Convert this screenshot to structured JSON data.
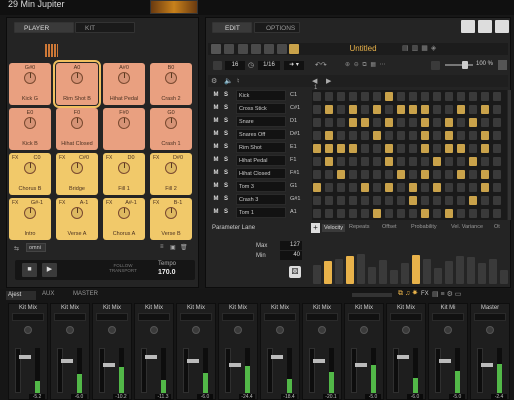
{
  "window": {
    "title": "29 Min Jupiter"
  },
  "left": {
    "tabs": [
      "PLAYER",
      "KIT"
    ],
    "output": "omni",
    "pads": [
      {
        "note": "G#0",
        "label": "Kick G",
        "color": "red"
      },
      {
        "note": "A0",
        "label": "Rim Shot B",
        "color": "red",
        "selected": true
      },
      {
        "note": "A#0",
        "label": "Hihat Pedal",
        "color": "red"
      },
      {
        "note": "B0",
        "label": "Crash 2",
        "color": "red"
      },
      {
        "note": "E0",
        "label": "Kick B",
        "color": "red"
      },
      {
        "note": "F0",
        "label": "Hihat Closed",
        "color": "red"
      },
      {
        "note": "F#0",
        "label": "",
        "color": "red"
      },
      {
        "note": "G0",
        "label": "Crash 1",
        "color": "red"
      },
      {
        "fx": "FX",
        "note": "C0",
        "label": "Chorus B",
        "color": "yellow"
      },
      {
        "fx": "FX",
        "note": "C#0",
        "label": "Bridge",
        "color": "yellow"
      },
      {
        "fx": "FX",
        "note": "D0",
        "label": "Fill 1",
        "color": "yellow"
      },
      {
        "fx": "FX",
        "note": "D#0",
        "label": "Fill 2",
        "color": "yellow"
      },
      {
        "fx": "FX",
        "note": "G#-1",
        "label": "Intro",
        "color": "yellow"
      },
      {
        "fx": "FX",
        "note": "A-1",
        "label": "Verse A",
        "color": "yellow"
      },
      {
        "fx": "FX",
        "note": "A#-1",
        "label": "Chorus A",
        "color": "yellow"
      },
      {
        "fx": "FX",
        "note": "B-1",
        "label": "Verse B",
        "color": "yellow"
      }
    ],
    "transport": {
      "follow": "FOLLOW TRANSPORT",
      "tempo_label": "Tempo",
      "tempo": "170.0"
    }
  },
  "right": {
    "tabs": [
      "EDIT",
      "OPTIONS"
    ],
    "pattern": "Untitled",
    "length": "16",
    "division": "1/16",
    "zoom": "100 %",
    "rows": [
      {
        "name": "Kick",
        "note": "C1"
      },
      {
        "name": "Cross Stick",
        "note": "C#1"
      },
      {
        "name": "Snare",
        "note": "D1"
      },
      {
        "name": "Snares Off",
        "note": "D#1"
      },
      {
        "name": "Rim Shot",
        "note": "E1"
      },
      {
        "name": "Hihat Pedal",
        "note": "F1"
      },
      {
        "name": "Hihat Closed",
        "note": "F#1"
      },
      {
        "name": "Tom 3",
        "note": "G1"
      },
      {
        "name": "Crash 3",
        "note": "G#1"
      },
      {
        "name": "Tom 1",
        "note": "A1"
      }
    ],
    "param_lane": "Parameter Lane",
    "max_label": "Max",
    "max": "127",
    "min_label": "Min",
    "min": "40",
    "lane_tabs": [
      "Velocity",
      "Repeats",
      "Offset",
      "Probability",
      "Vel. Variance",
      "Ot"
    ],
    "ms": {
      "m": "M",
      "s": "S"
    },
    "bar1": "1"
  },
  "mixer": {
    "tabs": [
      "Ajest",
      "AUX",
      "MASTER"
    ],
    "fx": "FX",
    "strips": [
      {
        "name": "Kit Mix",
        "db": "-5.2"
      },
      {
        "name": "Kit Mix",
        "db": "-6.0"
      },
      {
        "name": "Kit Mix",
        "db": "-10.2"
      },
      {
        "name": "Kit Mix",
        "db": "-11.3"
      },
      {
        "name": "Kit Mix",
        "db": "-6.0"
      },
      {
        "name": "Kit Mix",
        "db": "-24.4"
      },
      {
        "name": "Kit Mix",
        "db": "-18.4"
      },
      {
        "name": "Kit Mix",
        "db": "-20.1"
      },
      {
        "name": "Kit Mix",
        "db": "-5.0"
      },
      {
        "name": "Kit Mix",
        "db": "-6.0"
      },
      {
        "name": "Kit Mi",
        "db": "-5.0"
      },
      {
        "name": "Master",
        "db": "-2.4"
      }
    ]
  },
  "colors": {
    "accent": "#e8b24a",
    "pad_red": "#e9a080",
    "pad_yellow": "#f1c96a",
    "grid_on": "#c9a24a",
    "grid_off": "#3a3a3a"
  },
  "sequencer": {
    "active_cells": [
      [
        6
      ],
      [
        1,
        3,
        5,
        7,
        8,
        9,
        12,
        14
      ],
      [
        3,
        4,
        6,
        9,
        11,
        13
      ],
      [
        1,
        5,
        9,
        11,
        14
      ],
      [
        0,
        1,
        2,
        3,
        6,
        9,
        11,
        12,
        14
      ],
      [
        1,
        6,
        10,
        13
      ],
      [
        2,
        7,
        9,
        12,
        14
      ],
      [
        0,
        4,
        6,
        8,
        10,
        14
      ],
      [
        8,
        13
      ],
      [
        5,
        9,
        11
      ]
    ],
    "velocities": [
      0.42,
      0.5,
      0.55,
      0.6,
      0.65,
      0.38,
      0.52,
      0.3,
      0.45,
      0.62,
      0.55,
      0.35,
      0.5,
      0.6,
      0.58,
      0.45,
      0.55,
      0.3
    ]
  }
}
